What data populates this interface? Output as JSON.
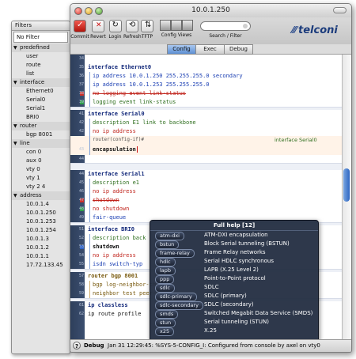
{
  "window": {
    "title": "10.0.1.250"
  },
  "toolbar": {
    "commit": "Commit",
    "revert": "Revert",
    "login": "Login",
    "refresh": "Refresh",
    "tftp": "TFTP",
    "config_views": "Config Views",
    "search_filter": "Search / Filter"
  },
  "brand": {
    "name": "telconi",
    "color": "#1c3c7c"
  },
  "tabs": [
    "Config",
    "Exec",
    "Debug"
  ],
  "active_tab": "Config",
  "filters": {
    "title": "Filters",
    "no_filter": "No Filter",
    "groups": [
      {
        "label": "predefined",
        "items": [
          "user",
          "route",
          "list"
        ]
      },
      {
        "label": "interface",
        "items": [
          "Ethernet0",
          "Serial0",
          "Serial1",
          "BRI0"
        ]
      },
      {
        "label": "router",
        "items": [
          "bgp 8001"
        ]
      },
      {
        "label": "line",
        "items": [
          "con 0",
          "aux 0",
          "vty 0",
          "vty 1",
          "vty 2 4"
        ]
      },
      {
        "label": "address",
        "items": [
          "10.0.1.4",
          "10.0.1.250",
          "10.0.1.253",
          "10.0.1.254",
          "10.0.1.3",
          "10.0.1.2",
          "10.0.1.1",
          "17.72.133.45"
        ]
      }
    ]
  },
  "editor": {
    "lines": [
      {
        "n": "34",
        "t": ""
      },
      {
        "n": "35",
        "t": "interface Ethernet0"
      },
      {
        "n": "36",
        "t": "ip address 10.0.1.250 255.255.255.0 secondary"
      },
      {
        "n": "37",
        "t": "ip address 10.0.1.253 255.255.255.0"
      },
      {
        "n": "38",
        "t": "no logging event link-status"
      },
      {
        "n": "39",
        "t": "logging event link-status"
      },
      {
        "n": "40",
        "t": ""
      },
      {
        "n": "41",
        "t": "interface Serial0"
      },
      {
        "n": "42",
        "t": "description E1 link to backbone"
      },
      {
        "n": "42",
        "t": "no ip address"
      },
      {
        "n": "",
        "t": "router(config-if)#"
      },
      {
        "n": "",
        "t": "interface Serial0"
      },
      {
        "n": "43",
        "t": "encapsulation"
      },
      {
        "n": "44",
        "t": ""
      },
      {
        "n": "",
        "t": ""
      },
      {
        "n": "44",
        "t": "interface Serial1"
      },
      {
        "n": "45",
        "t": "description e1"
      },
      {
        "n": "46",
        "t": "no ip address"
      },
      {
        "n": "47",
        "t": "shutdown"
      },
      {
        "n": "48",
        "t": "no shutdown"
      },
      {
        "n": "49",
        "t": "fair-queue"
      },
      {
        "n": "50",
        "t": ""
      },
      {
        "n": "51",
        "t": "interface BRI0"
      },
      {
        "n": "52",
        "t": "description back"
      },
      {
        "n": "53",
        "t": "shutdown"
      },
      {
        "n": "54",
        "t": "no ip address"
      },
      {
        "n": "55",
        "t": "isdn switch-typ"
      },
      {
        "n": "56",
        "t": ""
      },
      {
        "n": "57",
        "t": "router bgp 8001"
      },
      {
        "n": "58",
        "t": "bgp log-neighbor-changes"
      },
      {
        "n": "59",
        "t": "neighbor test peer-group"
      },
      {
        "n": "60",
        "t": ""
      },
      {
        "n": "61",
        "t": "ip classless"
      },
      {
        "n": "62",
        "t": "ip route profile"
      }
    ],
    "scroll_position": 0.45
  },
  "popup": {
    "title": "Full help [12]",
    "items": [
      {
        "cmd": "atm-dxi",
        "desc": "ATM-DXI encapsulation"
      },
      {
        "cmd": "bstun",
        "desc": "Block Serial tunneling (BSTUN)"
      },
      {
        "cmd": "frame-relay",
        "desc": "Frame Relay networks"
      },
      {
        "cmd": "hdlc",
        "desc": "Serial HDLC synchronous"
      },
      {
        "cmd": "lapb",
        "desc": "LAPB (X.25 Level 2)"
      },
      {
        "cmd": "ppp",
        "desc": "Point-to-Point protocol"
      },
      {
        "cmd": "sdlc",
        "desc": "SDLC"
      },
      {
        "cmd": "sdlc-primary",
        "desc": "SDLC (primary)"
      },
      {
        "cmd": "sdlc-secondary",
        "desc": "SDLC (secondary)"
      },
      {
        "cmd": "smds",
        "desc": "Switched Megabit Data Service (SMDS)"
      },
      {
        "cmd": "stun",
        "desc": "Serial tunneling (STUN)"
      },
      {
        "cmd": "x25",
        "desc": "X.25"
      }
    ]
  },
  "status": {
    "label": "Debug",
    "message": "Jan 31 12:29:45: %SYS-5-CONFIG_I: Configured from console by axel on vty0"
  }
}
